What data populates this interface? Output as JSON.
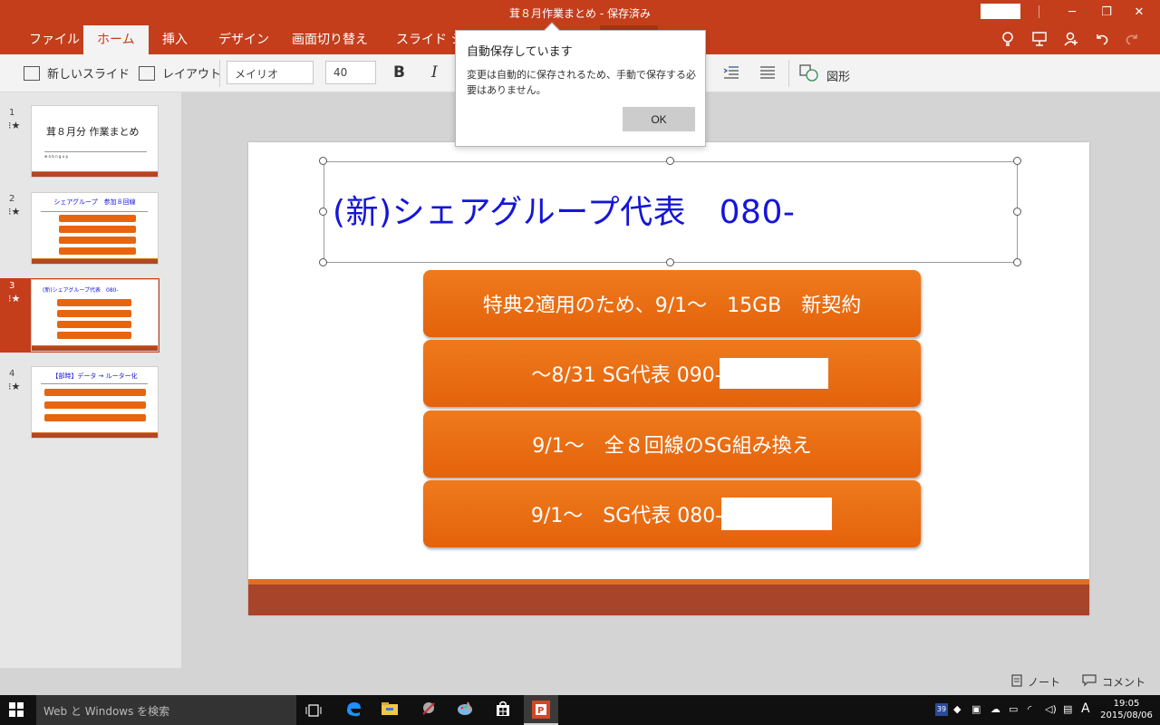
{
  "window": {
    "title": "茸８月作業まとめ - 保存済み",
    "controls": [
      "─",
      "❐",
      "✕"
    ]
  },
  "ribbon": {
    "tabs": [
      "ファイル",
      "ホーム",
      "挿入",
      "デザイン",
      "画面切り替え",
      "スライド シ"
    ],
    "active_tab": "ホーム"
  },
  "toolbar": {
    "new_slide": "新しいスライド",
    "layout": "レイアウト",
    "font_name": "メイリオ",
    "font_size": "40",
    "bold": "B",
    "italic": "I",
    "shapes": "図形"
  },
  "dialog": {
    "title": "自動保存しています",
    "message": "変更は自動的に保存されるため、手動で保存する必要はありません。",
    "ok": "OK"
  },
  "thumbnails": [
    {
      "num": "1",
      "title": "茸８月分 作業まとめ",
      "sub": "w  a b n g u p"
    },
    {
      "num": "2",
      "title": "シェアグループ　参加８回線"
    },
    {
      "num": "3",
      "title": "(新)シェアグループ代表　080-",
      "selected": true
    },
    {
      "num": "4",
      "title": "【部時】データ → ルーター化"
    }
  ],
  "slide": {
    "title": "(新)シェアグループ代表　080-",
    "bars": [
      "特典2適用のため、9/1～　15GB　新契約",
      "～8/31 SG代表 090-",
      "9/1～　全８回線のSG組み換え",
      "9/1～　SG代表 080-"
    ]
  },
  "status": {
    "notes": "ノート",
    "comments": "コメント"
  },
  "taskbar": {
    "search_placeholder": "Web と Windows を検索",
    "time": "19:05",
    "date": "2015/08/06",
    "ime": "A",
    "tray_badge": "39"
  },
  "colors": {
    "accent": "#c43e1c",
    "bar_orange": "#e8650d",
    "title_blue": "#1515d8"
  }
}
